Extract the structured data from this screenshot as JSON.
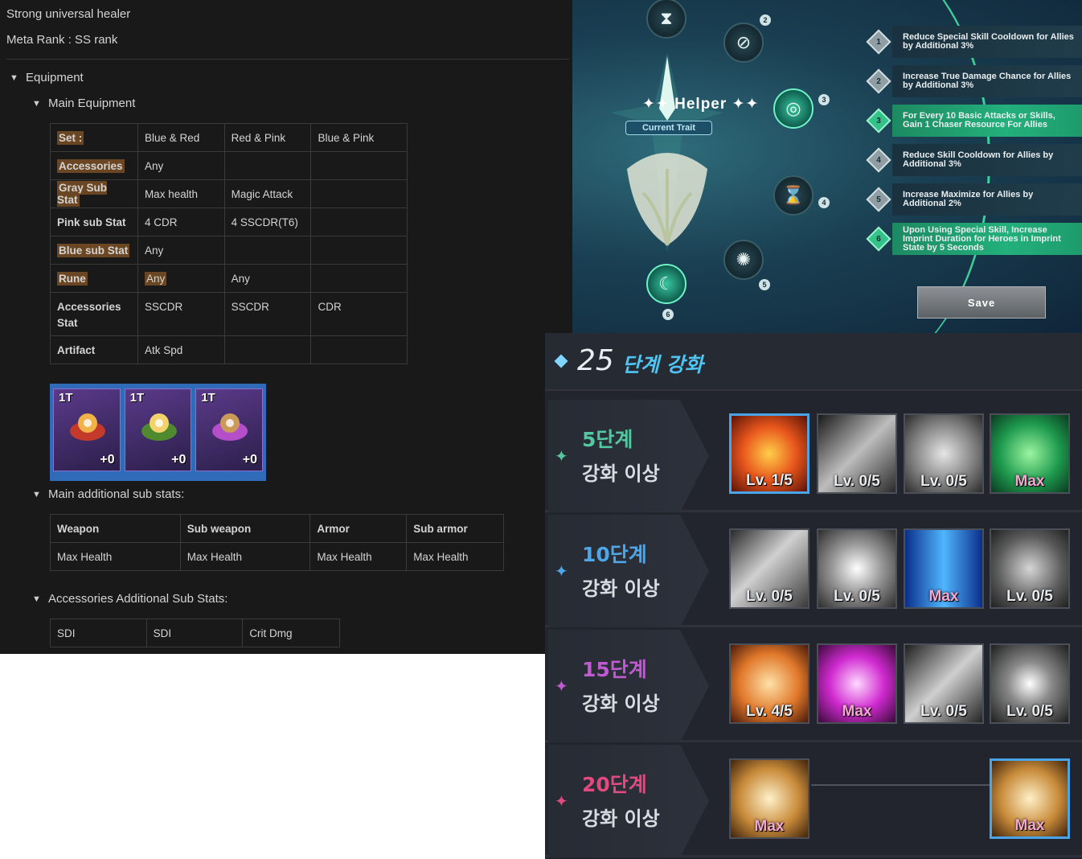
{
  "notes": {
    "line1": "Strong universal healer",
    "line2": "Meta Rank : SS rank",
    "equipment_toggle": "Equipment",
    "main_equipment_toggle": "Main Equipment",
    "equipment_table": [
      [
        "Set :",
        "Blue & Red",
        "Red & Pink",
        "Blue & Pink"
      ],
      [
        "Accessories",
        "Any",
        "",
        ""
      ],
      [
        "Gray Sub Stat",
        "Max health",
        "Magic Attack",
        ""
      ],
      [
        "Pink sub Stat",
        "4 CDR",
        "4 SSCDR(T6)",
        ""
      ],
      [
        "Blue sub Stat",
        "Any",
        "",
        ""
      ],
      [
        "Rune",
        "Any",
        "Any",
        ""
      ],
      [
        "Accessories Stat",
        "SSCDR",
        "SSCDR",
        "CDR"
      ],
      [
        "Artifact",
        "Atk Spd",
        "",
        ""
      ]
    ],
    "artifacts": [
      {
        "tier": "1T",
        "enhance": "+0",
        "icon": "ruby-ring-icon"
      },
      {
        "tier": "1T",
        "enhance": "+0",
        "icon": "emerald-amulet-icon"
      },
      {
        "tier": "1T",
        "enhance": "+0",
        "icon": "crystal-cart-icon"
      }
    ],
    "main_additional_toggle": "Main additional sub stats:",
    "main_additional_table": {
      "headers": [
        "Weapon",
        "Sub weapon",
        "Armor",
        "Sub armor"
      ],
      "values": [
        "Max Health",
        "Max Health",
        "Max Health",
        "Max Health"
      ]
    },
    "accessories_additional_toggle": "Accessories Additional Sub Stats:",
    "accessories_additional_table": [
      "SDI",
      "SDI",
      "Crit Dmg"
    ],
    "highlight_color": "#6b4622"
  },
  "trait": {
    "title": "Helper",
    "badge": "Current Trait",
    "nodes": [
      "1",
      "2",
      "3",
      "4",
      "5",
      "6"
    ],
    "rows": [
      {
        "num": "1",
        "text": "Reduce Special Skill Cooldown for Allies by Additional 3%",
        "active": false
      },
      {
        "num": "2",
        "text": "Increase True Damage Chance for Allies by Additional 3%",
        "active": false
      },
      {
        "num": "3",
        "text": "For Every 10 Basic Attacks or Skills, Gain 1 Chaser Resource For Allies",
        "active": true
      },
      {
        "num": "4",
        "text": "Reduce Skill Cooldown for Allies by Additional 3%",
        "active": false
      },
      {
        "num": "5",
        "text": "Increase Maximize for Allies by Additional 2%",
        "active": false
      },
      {
        "num": "6",
        "text": "Upon Using Special Skill, Increase Imprint Duration for Heroes in Imprint State by 5 Seconds",
        "active": true
      }
    ],
    "save_label": "Save",
    "active_color": "#23b07c"
  },
  "enhancement": {
    "number": "25",
    "title": "단계 강화",
    "tiers": [
      {
        "label": "5단계",
        "sub": "강화 이상",
        "color": "#52c7a0",
        "skills": [
          {
            "lv": "Lv. 1/5",
            "icon": "flame-fist-icon",
            "selected": true
          },
          {
            "lv": "Lv. 0/5",
            "icon": "blade-slash-icon"
          },
          {
            "lv": "Lv. 0/5",
            "icon": "water-drop-icon"
          },
          {
            "lv": "Max",
            "icon": "hourglass-burst-icon"
          }
        ]
      },
      {
        "label": "10단계",
        "sub": "강화 이상",
        "color": "#4ea6e6",
        "skills": [
          {
            "lv": "Lv. 0/5",
            "icon": "claw-swipe-icon"
          },
          {
            "lv": "Lv. 0/5",
            "icon": "radiant-orb-icon"
          },
          {
            "lv": "Max",
            "icon": "blue-pillar-icon"
          },
          {
            "lv": "Lv. 0/5",
            "icon": "healing-cross-icon"
          }
        ]
      },
      {
        "label": "15단계",
        "sub": "강화 이상",
        "color": "#c05ad0",
        "skills": [
          {
            "lv": "Lv. 4/5",
            "icon": "sword-crest-icon"
          },
          {
            "lv": "Max",
            "icon": "magenta-orb-icon"
          },
          {
            "lv": "Lv. 0/5",
            "icon": "wind-arc-icon"
          },
          {
            "lv": "Lv. 0/5",
            "icon": "nova-burst-icon"
          }
        ]
      },
      {
        "label": "20단계",
        "sub": "강화 이상",
        "color": "#e04a7e",
        "skills": [
          {
            "lv": "Max",
            "icon": "golden-scroll-icon"
          },
          {
            "lv": "Max",
            "icon": "golden-scroll-icon",
            "selected": true
          }
        ]
      }
    ]
  }
}
